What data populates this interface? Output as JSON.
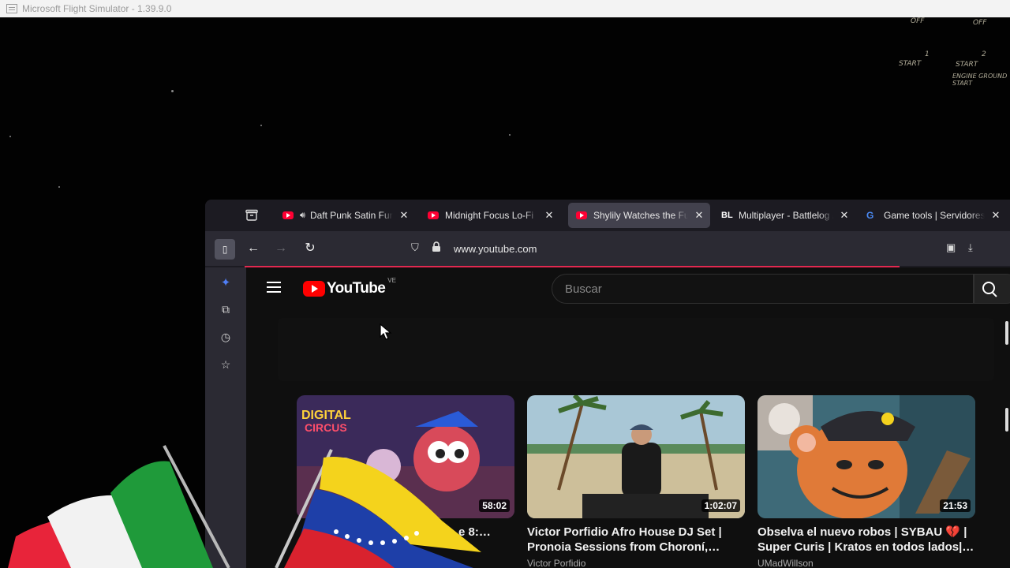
{
  "os_window": {
    "title": "Microsoft Flight Simulator - 1.39.9.0"
  },
  "cockpit": {
    "labels": [
      "OFF",
      "OFF",
      "1",
      "START",
      "2",
      "START",
      "ENGINE GROUND START"
    ]
  },
  "browser": {
    "tabs": [
      {
        "title": "Daft Punk Satin Funk",
        "favicon": "youtube-icon",
        "audio": true,
        "active": false
      },
      {
        "title": "Midnight Focus Lo-Fi",
        "favicon": "youtube-icon",
        "audio": false,
        "active": false
      },
      {
        "title": "Shylily Watches the Funny",
        "favicon": "youtube-icon",
        "audio": false,
        "active": true
      },
      {
        "title": "Multiplayer - Battlelog / B",
        "favicon": "BL",
        "audio": false,
        "active": false
      },
      {
        "title": "Game tools | Servidores",
        "favicon": "G",
        "audio": false,
        "active": false
      }
    ],
    "url": "www.youtube.com",
    "colors": {
      "tab_active": "#42414d",
      "progress": "#e22850"
    }
  },
  "youtube": {
    "logo_text": "YouTube",
    "country_code": "VE",
    "search_placeholder": "Buscar",
    "videos": [
      {
        "title": "…NE …e 8:…",
        "channel": "",
        "duration": "58:02",
        "thumbnail": "digital-circus-thumbnail"
      },
      {
        "title": "Victor Porfidio Afro House DJ Set | Pronoia Sessions from Choroní,…",
        "channel": "Victor Porfidio",
        "duration": "1:02:07",
        "thumbnail": "beach-dj-thumbnail"
      },
      {
        "title": "Obselva el nuevo robos | SYBAU 💔 | Super Curis | Kratos en todos lados|…",
        "channel": "UMadWillson",
        "duration": "21:53",
        "thumbnail": "cartoon-mouse-thumbnail"
      }
    ]
  },
  "overlay": {
    "flags": [
      "italy-flag",
      "venezuela-flag"
    ]
  }
}
